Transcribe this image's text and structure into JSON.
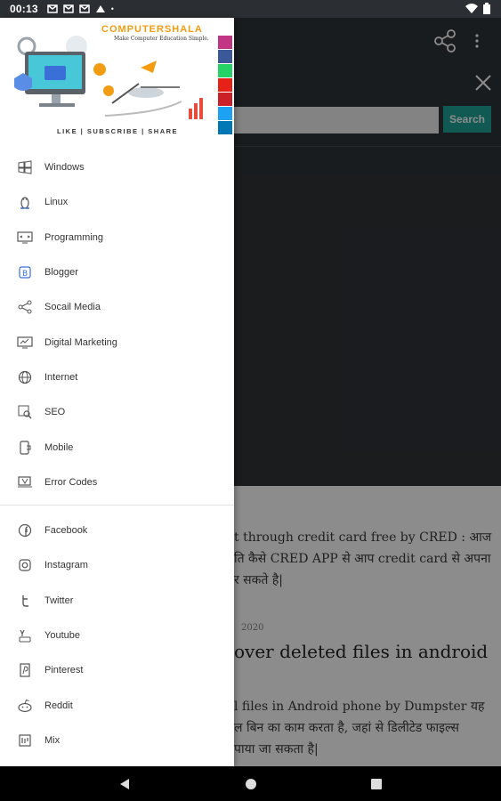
{
  "status_bar": {
    "time": "00:13",
    "dot": "•"
  },
  "app": {
    "search_button": "Search",
    "article1": {
      "line1": "t through credit card free by CRED : आज",
      "line2": "ति कैसे CRED APP से आप credit card से अपना",
      "line3": "र सकते है|"
    },
    "date": "2020",
    "article2": {
      "title": "over deleted files in android",
      "line1": "l files in Android phone by Dumpster यह",
      "line2": "ल बिन का काम करता है, जहां से डिलीटेड फाइल्स",
      "line3": "पाया जा सकता है|"
    }
  },
  "drawer": {
    "banner": {
      "brand": "COMPUTERSHALA",
      "tagline": "Make Computer Education Simple.",
      "footer": "LIKE | SUBSCRIBE | SHARE"
    },
    "categories": [
      {
        "label": "Windows",
        "icon": "windows-icon"
      },
      {
        "label": "Linux",
        "icon": "linux-icon"
      },
      {
        "label": "Programming",
        "icon": "programming-icon"
      },
      {
        "label": "Blogger",
        "icon": "blogger-icon"
      },
      {
        "label": "Socail Media",
        "icon": "share-icon"
      },
      {
        "label": "Digital Marketing",
        "icon": "monitor-icon"
      },
      {
        "label": "Internet",
        "icon": "globe-icon"
      },
      {
        "label": "SEO",
        "icon": "seo-icon"
      },
      {
        "label": "Mobile",
        "icon": "mobile-icon"
      },
      {
        "label": "Error Codes",
        "icon": "error-icon"
      }
    ],
    "social": [
      {
        "label": "Facebook",
        "icon": "facebook-icon"
      },
      {
        "label": "Instagram",
        "icon": "instagram-icon"
      },
      {
        "label": "Twitter",
        "icon": "twitter-icon"
      },
      {
        "label": "Youtube",
        "icon": "youtube-icon"
      },
      {
        "label": "Pinterest",
        "icon": "pinterest-icon"
      },
      {
        "label": "Reddit",
        "icon": "reddit-icon"
      },
      {
        "label": "Mix",
        "icon": "mix-icon"
      }
    ]
  },
  "colors": {
    "accent": "#1fa59a",
    "brand_orange": "#f39c12",
    "toolbar": "#2f3338"
  }
}
